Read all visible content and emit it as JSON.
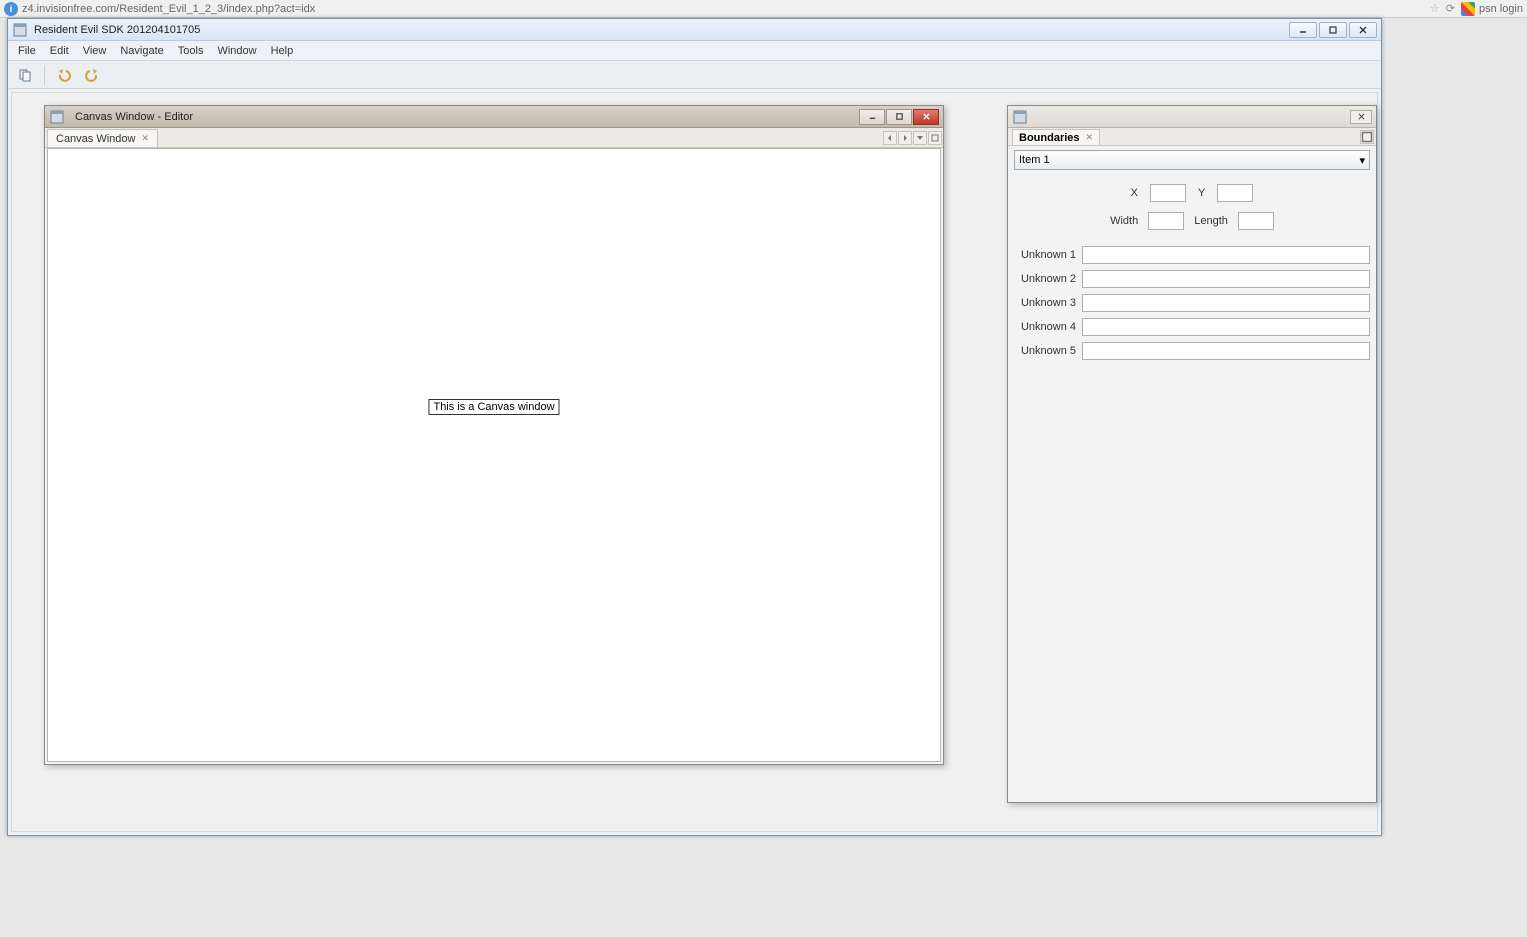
{
  "browser": {
    "url": "z4.invisionfree.com/Resident_Evil_1_2_3/index.php?act=idx",
    "tab2_label": "psn login"
  },
  "app": {
    "title": "Resident Evil SDK 201204101705",
    "menu": [
      "File",
      "Edit",
      "View",
      "Navigate",
      "Tools",
      "Window",
      "Help"
    ]
  },
  "canvas_window": {
    "title": "Canvas Window - Editor",
    "tab_label": "Canvas Window",
    "body_text": "This is a Canvas window"
  },
  "props": {
    "tab_label": "Boundaries",
    "combo_value": "Item 1",
    "fields": {
      "x_label": "X",
      "y_label": "Y",
      "width_label": "Width",
      "length_label": "Length",
      "unknown_labels": [
        "Unknown 1",
        "Unknown 2",
        "Unknown 3",
        "Unknown 4",
        "Unknown 5"
      ]
    }
  }
}
